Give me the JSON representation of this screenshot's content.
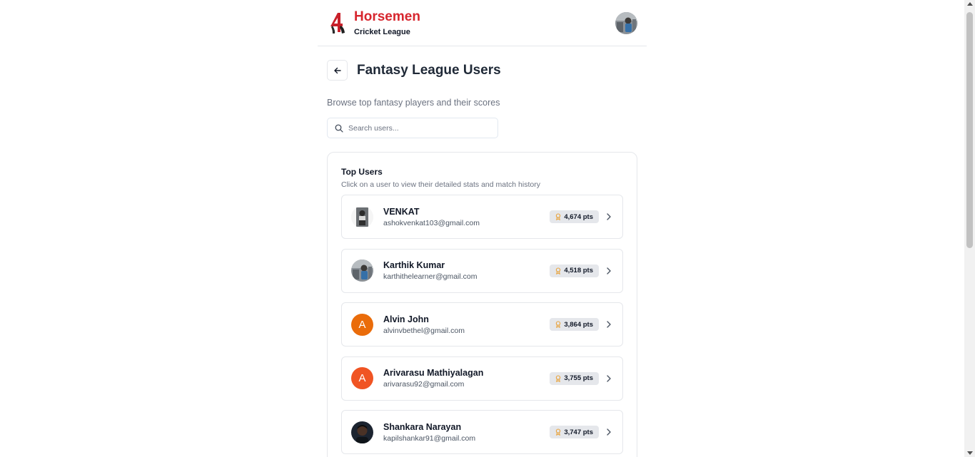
{
  "brand": {
    "name": "Horsemen",
    "subtitle": "Cricket League",
    "color": "#d7262e"
  },
  "page": {
    "title": "Fantasy League Users",
    "subtitle": "Browse top fantasy players and their scores"
  },
  "search": {
    "placeholder": "Search users...",
    "value": ""
  },
  "card": {
    "title": "Top Users",
    "description": "Click on a user to view their detailed stats and match history"
  },
  "users": [
    {
      "name": "VENKAT",
      "email": "ashokvenkat103@gmail.com",
      "points": "4,674 pts",
      "avatar": "photo"
    },
    {
      "name": "Karthik Kumar",
      "email": "karthithelearner@gmail.com",
      "points": "4,518 pts",
      "avatar": "photo"
    },
    {
      "name": "Alvin John",
      "email": "alvinvbethel@gmail.com",
      "points": "3,864 pts",
      "avatar": "initial",
      "initial": "A",
      "avatar_color": "#ea6c0a"
    },
    {
      "name": "Arivarasu Mathiyalagan",
      "email": "arivarasu92@gmail.com",
      "points": "3,755 pts",
      "avatar": "initial",
      "initial": "A",
      "avatar_color": "#f05423"
    },
    {
      "name": "Shankara Narayan",
      "email": "kapilshankar91@gmail.com",
      "points": "3,747 pts",
      "avatar": "photo"
    }
  ],
  "icons": {
    "back": "arrow-left-icon",
    "search": "search-icon",
    "points": "trophy-icon",
    "row": "chevron-right-icon"
  },
  "colors": {
    "accent": "#d7262e",
    "trophy": "#e8a23a",
    "points_bg": "#e5e7eb"
  }
}
